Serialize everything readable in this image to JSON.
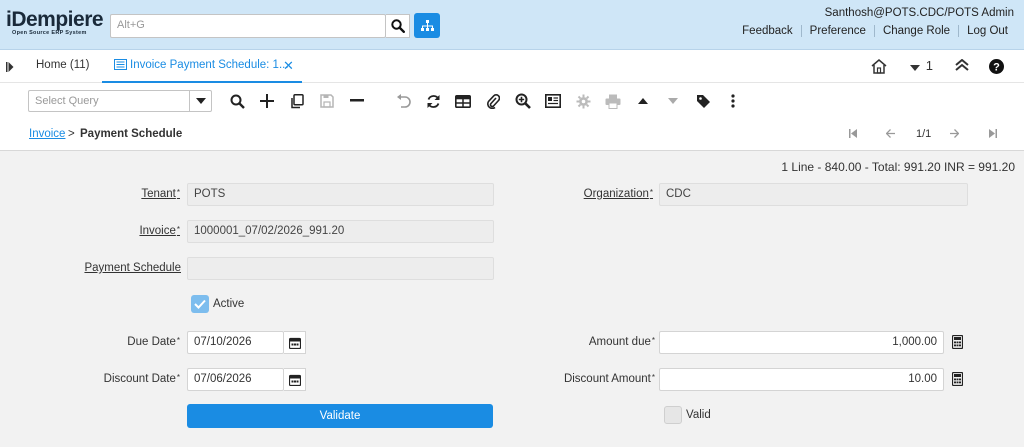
{
  "header": {
    "logo_main": "iDempiere",
    "logo_sub": "Open Source ERP System",
    "search_placeholder": "Alt+G",
    "user": "Santhosh@POTS.CDC/POTS Admin",
    "links": [
      "Feedback",
      "Preference",
      "Change Role",
      "Log Out"
    ]
  },
  "tabs": {
    "home": "Home (11)",
    "active": "Invoice Payment Schedule: 1...",
    "window_count": "1"
  },
  "toolbar": {
    "query_placeholder": "Select Query"
  },
  "breadcrumb": {
    "parent": "Invoice",
    "separator": ">",
    "current": "Payment Schedule",
    "record": "1/1"
  },
  "form": {
    "status": "1 Line - 840.00 - Total: 991.20 INR = 991.20",
    "tenant_label": "Tenant",
    "tenant_value": "POTS",
    "organization_label": "Organization",
    "organization_value": "CDC",
    "invoice_label": "Invoice",
    "invoice_value": "1000001_07/02/2026_991.20",
    "payment_schedule_label": "Payment Schedule",
    "payment_schedule_value": "",
    "active_label": "Active",
    "due_date_label": "Due Date",
    "due_date_value": "07/10/2026",
    "amount_due_label": "Amount due",
    "amount_due_value": "1,000.00",
    "discount_date_label": "Discount Date",
    "discount_date_value": "07/06/2026",
    "discount_amount_label": "Discount Amount",
    "discount_amount_value": "10.00",
    "validate_label": "Validate",
    "valid_label": "Valid",
    "required_mark": "*"
  },
  "colors": {
    "header_bg": "#cfe6f7",
    "accent": "#1a8ce3"
  }
}
